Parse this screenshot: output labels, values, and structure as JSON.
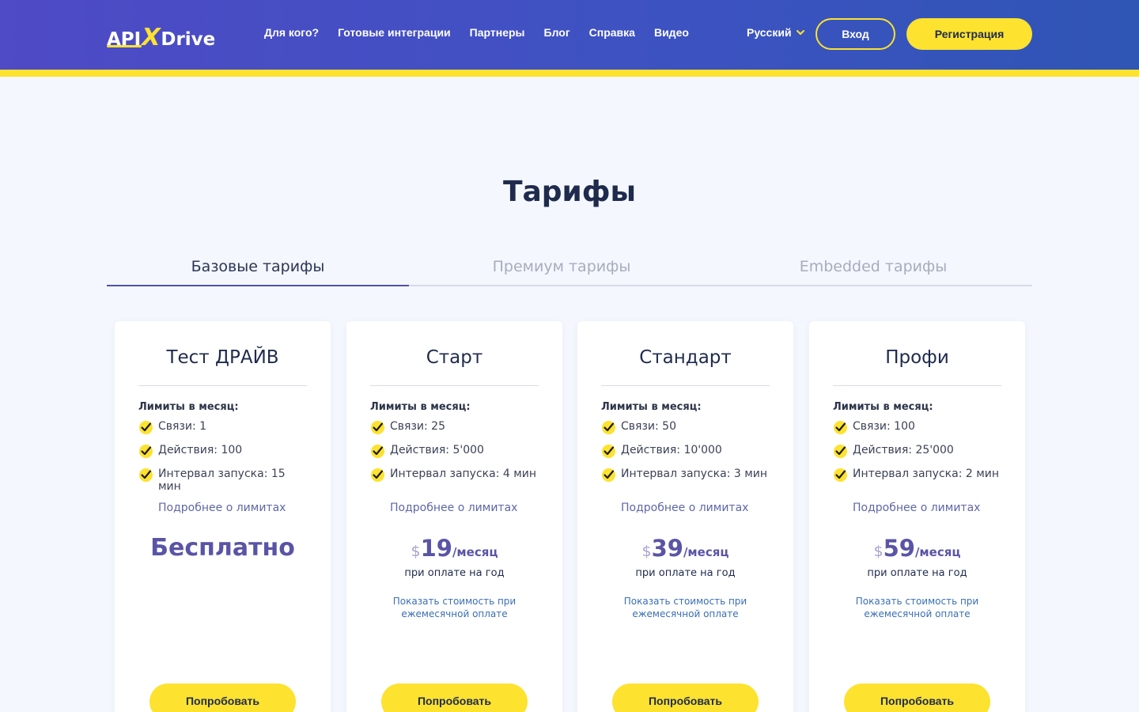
{
  "header": {
    "logo": {
      "part1": "API",
      "x": "X",
      "part2": "Drive"
    },
    "nav": [
      "Для кого?",
      "Готовые интеграции",
      "Партнеры",
      "Блог",
      "Справка",
      "Видео"
    ],
    "language": "Русский",
    "login_label": "Вход",
    "register_label": "Регистрация"
  },
  "colors": {
    "accent_yellow": "#fde22f",
    "header_blue": "#4f4ac6",
    "price_purple": "#5a54a6"
  },
  "page_title": "Тарифы",
  "tabs": [
    {
      "label": "Базовые тарифы",
      "active": true
    },
    {
      "label": "Премиум тарифы",
      "active": false
    },
    {
      "label": "Embedded тарифы",
      "active": false
    }
  ],
  "plans": [
    {
      "title": "Тест ДРАЙВ",
      "limits_label": "Лимиты в месяц:",
      "features": [
        "Связи: 1",
        "Действия: 100",
        "Интервал запуска: 15 мин"
      ],
      "more_link": "Подробнее о лимитах",
      "free_label": "Бесплатно",
      "button": "Попробовать"
    },
    {
      "title": "Старт",
      "limits_label": "Лимиты в месяц:",
      "features": [
        "Связи: 25",
        "Действия: 5'000",
        "Интервал запуска: 4 мин"
      ],
      "more_link": "Подробнее о лимитах",
      "currency": "$",
      "amount": "19",
      "period": "/месяц",
      "note": "при оплате на год",
      "monthly_link": "Показать стоимость при ежемесячной оплате",
      "button": "Попробовать"
    },
    {
      "title": "Стандарт",
      "limits_label": "Лимиты в месяц:",
      "features": [
        "Связи: 50",
        "Действия: 10'000",
        "Интервал запуска: 3 мин"
      ],
      "more_link": "Подробнее о лимитах",
      "currency": "$",
      "amount": "39",
      "period": "/месяц",
      "note": "при оплате на год",
      "monthly_link": "Показать стоимость при ежемесячной оплате",
      "button": "Попробовать"
    },
    {
      "title": "Профи",
      "limits_label": "Лимиты в месяц:",
      "features": [
        "Связи: 100",
        "Действия: 25'000",
        "Интервал запуска: 2 мин"
      ],
      "more_link": "Подробнее о лимитах",
      "currency": "$",
      "amount": "59",
      "period": "/месяц",
      "note": "при оплате на год",
      "monthly_link": "Показать стоимость при ежемесячной оплате",
      "button": "Попробовать"
    }
  ]
}
